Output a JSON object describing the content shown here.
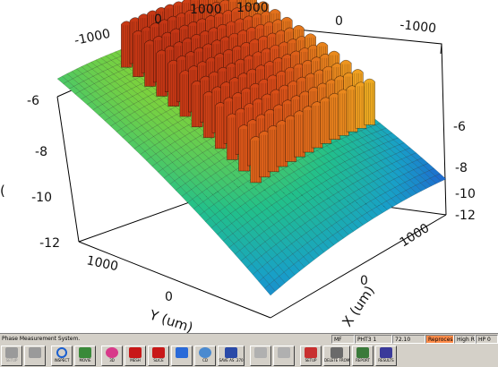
{
  "plot": {
    "title": "",
    "left_z_ticks": [
      "-6",
      "-8",
      "-10",
      "-12"
    ],
    "right_z_ticks": [
      "-6",
      "-8",
      "-10",
      "-12"
    ],
    "top_y_ticks": [
      "-1000",
      "0",
      "1000"
    ],
    "top_x_ticks": [
      "1000",
      "0",
      "-1000"
    ],
    "bottom_y_ticks": [
      "1000",
      "0"
    ],
    "bottom_x_ticks": [
      "1000",
      "0"
    ],
    "y_axis_label": "Y (um)",
    "x_axis_label": "X (um)",
    "left_edge_label": "(",
    "colormap": [
      "#0a1a8c",
      "#1f5fd0",
      "#18a0c8",
      "#22c08a",
      "#7fd23a",
      "#e5e72a",
      "#f0a020",
      "#d84a18",
      "#a81810"
    ]
  },
  "statusbar": {
    "message": "Phase Measurement System.",
    "mf": "MF",
    "mode": "PHT3 1",
    "value": "72.10",
    "reprocessing": "Reprocessing",
    "hires": "High Res.",
    "hp": "HP 0"
  },
  "toolbar": {
    "buttons": [
      {
        "label": "SETUP",
        "icon": "setup-icon",
        "disabled": true
      },
      {
        "label": "",
        "icon": "minus-icon",
        "disabled": true
      },
      {
        "label": "INSPECT",
        "icon": "magnifier-icon",
        "disabled": false
      },
      {
        "label": "MOVIE",
        "icon": "movie-icon",
        "disabled": false
      },
      {
        "label": "3D",
        "icon": "ball-icon",
        "disabled": false
      },
      {
        "label": "MESH",
        "icon": "3d-mesh-icon",
        "disabled": false
      },
      {
        "label": "SLICE",
        "icon": "3d-slice-icon",
        "disabled": false
      },
      {
        "label": "",
        "icon": "layers-icon",
        "disabled": false
      },
      {
        "label": "CD",
        "icon": "cd-icon",
        "disabled": false
      },
      {
        "label": "SAVE AS .370",
        "icon": "save-icon",
        "disabled": false
      },
      {
        "label": "",
        "icon": "disabled-icon",
        "disabled": true
      },
      {
        "label": "",
        "icon": "disabled-icon",
        "disabled": true
      },
      {
        "label": "SETUP",
        "icon": "report-setup-icon",
        "disabled": false
      },
      {
        "label": "DELETE FROM REPORT",
        "icon": "delete-icon",
        "disabled": false
      },
      {
        "label": "REPORT",
        "icon": "report-icon",
        "disabled": false
      },
      {
        "label": "RESULTS",
        "icon": "results-icon",
        "disabled": false
      }
    ]
  }
}
